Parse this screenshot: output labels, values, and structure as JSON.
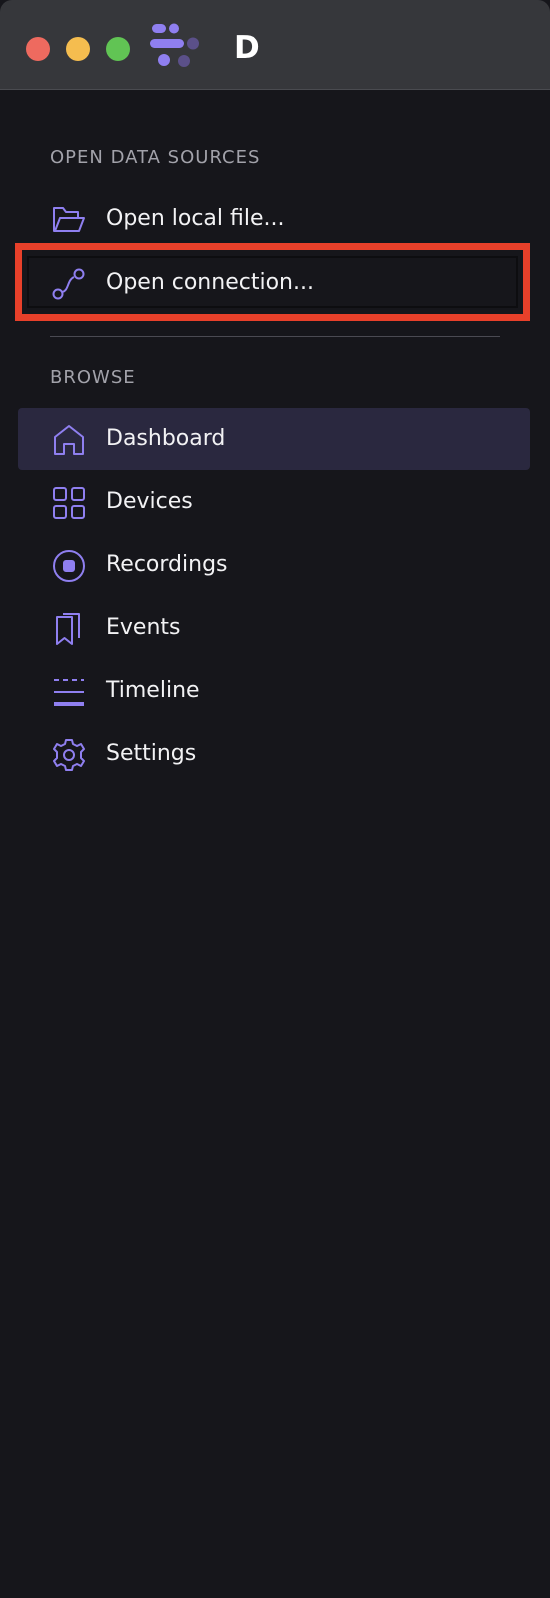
{
  "window": {
    "title": "D"
  },
  "sections": {
    "open_data_sources": {
      "heading": "OPEN DATA SOURCES",
      "items": [
        {
          "label": "Open local file...",
          "icon": "folder-open-icon"
        },
        {
          "label": "Open connection...",
          "icon": "connection-icon",
          "highlighted": true
        }
      ]
    },
    "browse": {
      "heading": "BROWSE",
      "items": [
        {
          "label": "Dashboard",
          "icon": "home-icon",
          "active": true
        },
        {
          "label": "Devices",
          "icon": "grid-icon"
        },
        {
          "label": "Recordings",
          "icon": "record-icon"
        },
        {
          "label": "Events",
          "icon": "bookmarks-icon"
        },
        {
          "label": "Timeline",
          "icon": "timeline-icon"
        },
        {
          "label": "Settings",
          "icon": "gear-icon"
        }
      ]
    }
  },
  "colors": {
    "accent": "#8f7ff0",
    "highlight": "#e8402a",
    "active_bg": "#2a283f",
    "background": "#16161b",
    "titlebar": "#36373b"
  }
}
